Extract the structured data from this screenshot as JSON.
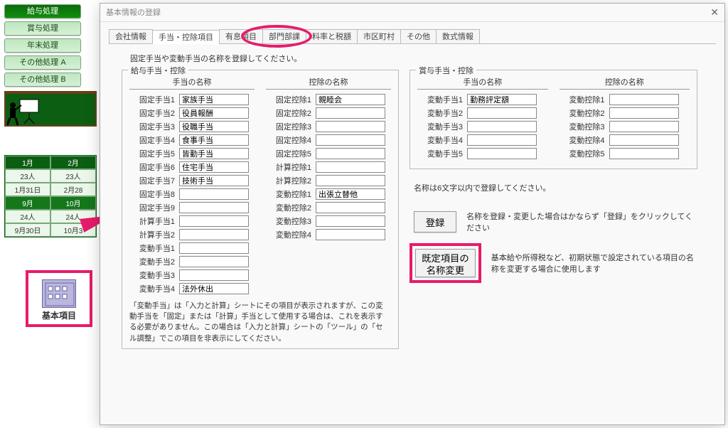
{
  "sidebar": {
    "buttons": [
      "給与処理",
      "賞与処理",
      "年末処理",
      "その他処理 A",
      "その他処理 B"
    ],
    "basic_item_label": "基本項目"
  },
  "calendar": {
    "rows": [
      {
        "h": [
          "1月",
          "2月"
        ],
        "head": true
      },
      {
        "h": [
          "23人",
          "23人"
        ]
      },
      {
        "h": [
          "1月31日",
          "2月28"
        ]
      },
      {
        "h": [
          "9月",
          "10月"
        ],
        "head": true,
        "alt": true
      },
      {
        "h": [
          "24人",
          "24人"
        ]
      },
      {
        "h": [
          "9月30日",
          "10月3"
        ]
      }
    ]
  },
  "dialog": {
    "title": "基本情報の登録",
    "tabs": [
      "会社情報",
      "手当・控除項目",
      "有息項目",
      "部門部課",
      "料率と税額",
      "市区町村",
      "その他",
      "数式情報"
    ],
    "active_tab": 1,
    "instruction": "固定手当や変動手当の名称を登録してください。",
    "salary": {
      "legend": "給与手当・控除",
      "allow_header": "手当の名称",
      "deduct_header": "控除の名称",
      "allowances": [
        {
          "label": "固定手当1",
          "value": "家族手当"
        },
        {
          "label": "固定手当2",
          "value": "役員報酬"
        },
        {
          "label": "固定手当3",
          "value": "役職手当"
        },
        {
          "label": "固定手当4",
          "value": "食事手当"
        },
        {
          "label": "固定手当5",
          "value": "皆勤手当"
        },
        {
          "label": "固定手当6",
          "value": "住宅手当"
        },
        {
          "label": "固定手当7",
          "value": "技術手当"
        },
        {
          "label": "固定手当8",
          "value": ""
        },
        {
          "label": "固定手当9",
          "value": ""
        },
        {
          "label": "計算手当1",
          "value": ""
        },
        {
          "label": "計算手当2",
          "value": ""
        },
        {
          "label": "変動手当1",
          "value": ""
        },
        {
          "label": "変動手当2",
          "value": ""
        },
        {
          "label": "変動手当3",
          "value": ""
        },
        {
          "label": "変動手当4",
          "value": "法外休出"
        }
      ],
      "deductions": [
        {
          "label": "固定控除1",
          "value": "親睦会"
        },
        {
          "label": "固定控除2",
          "value": ""
        },
        {
          "label": "固定控除3",
          "value": ""
        },
        {
          "label": "固定控除4",
          "value": ""
        },
        {
          "label": "固定控除5",
          "value": ""
        },
        {
          "label": "計算控除1",
          "value": ""
        },
        {
          "label": "計算控除2",
          "value": ""
        },
        {
          "label": "変動控除1",
          "value": "出張立替他"
        },
        {
          "label": "変動控除2",
          "value": ""
        },
        {
          "label": "変動控除3",
          "value": ""
        },
        {
          "label": "変動控除4",
          "value": ""
        }
      ],
      "note": "「変動手当」は「入力と計算」シートにその項目が表示されますが、この変動手当を「固定」または「計算」手当として使用する場合は、これを表示する必要がありません。この場合は「入力と計算」シートの「ツール」の「セル調整」でこの項目を非表示にしてください。"
    },
    "bonus": {
      "legend": "賞与手当・控除",
      "allow_header": "手当の名称",
      "deduct_header": "控除の名称",
      "allowances": [
        {
          "label": "変動手当1",
          "value": "勤務評定額"
        },
        {
          "label": "変動手当2",
          "value": ""
        },
        {
          "label": "変動手当3",
          "value": ""
        },
        {
          "label": "変動手当4",
          "value": ""
        },
        {
          "label": "変動手当5",
          "value": ""
        }
      ],
      "deductions": [
        {
          "label": "変動控除1",
          "value": ""
        },
        {
          "label": "変動控除2",
          "value": ""
        },
        {
          "label": "変動控除3",
          "value": ""
        },
        {
          "label": "変動控除4",
          "value": ""
        },
        {
          "label": "変動控除5",
          "value": ""
        }
      ],
      "limit_note": "名称は6文字以内で登録してください。"
    },
    "register_btn": "登録",
    "register_note": "名称を登録・変更した場合はかならず「登録」をクリックしてください",
    "change_btn_l1": "既定項目の",
    "change_btn_l2": "名称変更",
    "change_note": "基本給や所得税など、初期状態で設定されている項目の名称を変更する場合に使用します"
  }
}
